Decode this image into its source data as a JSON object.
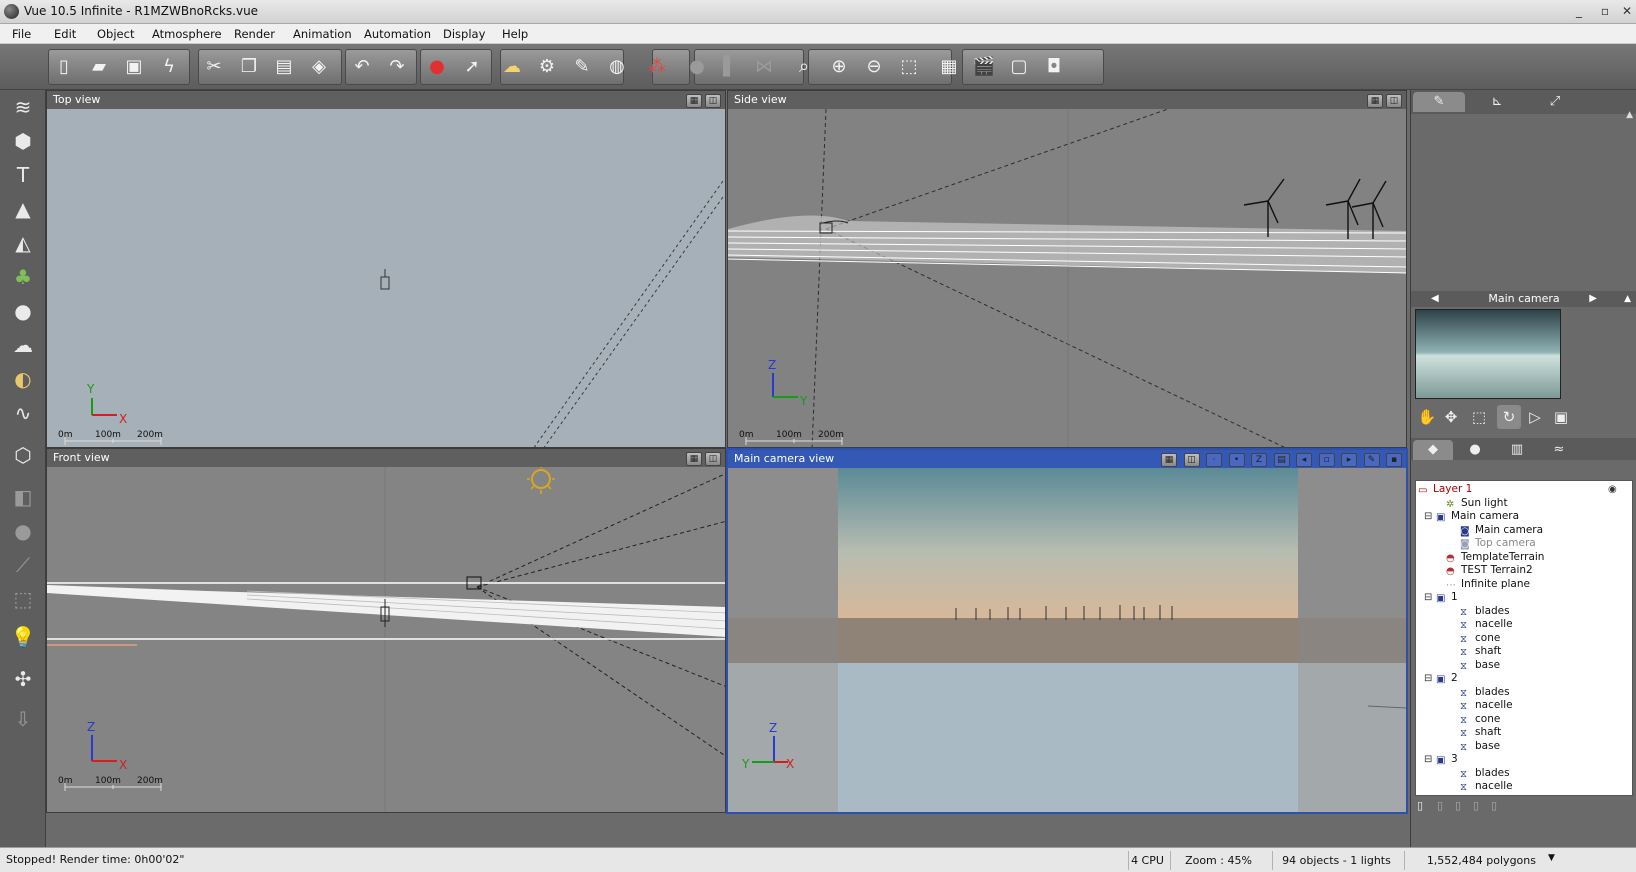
{
  "window": {
    "title": "Vue 10.5 Infinite - R1MZWBnoRcks.vue",
    "minimize": "_",
    "maximize": "▫",
    "close": "✕"
  },
  "menu": [
    "File",
    "Edit",
    "Object",
    "Atmosphere",
    "Render",
    "Animation",
    "Automation",
    "Display",
    "Help"
  ],
  "viewports": {
    "top": {
      "title": "Top view",
      "axis1": "Y",
      "axis2": "X",
      "scale": [
        "0m",
        "100m",
        "200m"
      ]
    },
    "side": {
      "title": "Side view",
      "axis1": "Z",
      "axis2": "Y",
      "scale": [
        "0m",
        "100m",
        "200m"
      ]
    },
    "front": {
      "title": "Front view",
      "axis1": "Z",
      "axis2": "X",
      "scale": [
        "0m",
        "100m",
        "200m"
      ]
    },
    "camera": {
      "title": "Main camera view",
      "axis1": "Z",
      "axis2": "X",
      "axis3": "Y"
    }
  },
  "right_panel": {
    "camera_selector": "Main camera",
    "tree": [
      {
        "label": "Layer 1",
        "type": "layer"
      },
      {
        "label": "Sun light",
        "type": "light"
      },
      {
        "label": "Main camera",
        "type": "camgroup"
      },
      {
        "label": "Main camera",
        "type": "camera"
      },
      {
        "label": "Top camera",
        "type": "camera-dim"
      },
      {
        "label": "TemplateTerrain",
        "type": "terrain"
      },
      {
        "label": "TEST Terrain2",
        "type": "terrain"
      },
      {
        "label": "Infinite plane",
        "type": "plane"
      },
      {
        "label": "1",
        "type": "group"
      },
      {
        "label": "blades",
        "type": "part"
      },
      {
        "label": "nacelle",
        "type": "part"
      },
      {
        "label": "cone",
        "type": "part"
      },
      {
        "label": "shaft",
        "type": "part"
      },
      {
        "label": "base",
        "type": "part"
      },
      {
        "label": "2",
        "type": "group"
      },
      {
        "label": "blades",
        "type": "part"
      },
      {
        "label": "nacelle",
        "type": "part"
      },
      {
        "label": "cone",
        "type": "part"
      },
      {
        "label": "shaft",
        "type": "part"
      },
      {
        "label": "base",
        "type": "part"
      },
      {
        "label": "3",
        "type": "group"
      },
      {
        "label": "blades",
        "type": "part"
      },
      {
        "label": "nacelle",
        "type": "part"
      }
    ]
  },
  "status": {
    "message": "Stopped! Render time: 0h00'02\"",
    "cpu": "4 CPU",
    "zoom": "Zoom : 45%",
    "objects": "94 objects - 1 lights",
    "polygons": "1,552,484 polygons"
  },
  "colors": {
    "active_viewport": "#3358b5",
    "layer_text": "#b00000",
    "top_view_bg": "#a5b0b8",
    "viewport_bg": "#838383"
  }
}
